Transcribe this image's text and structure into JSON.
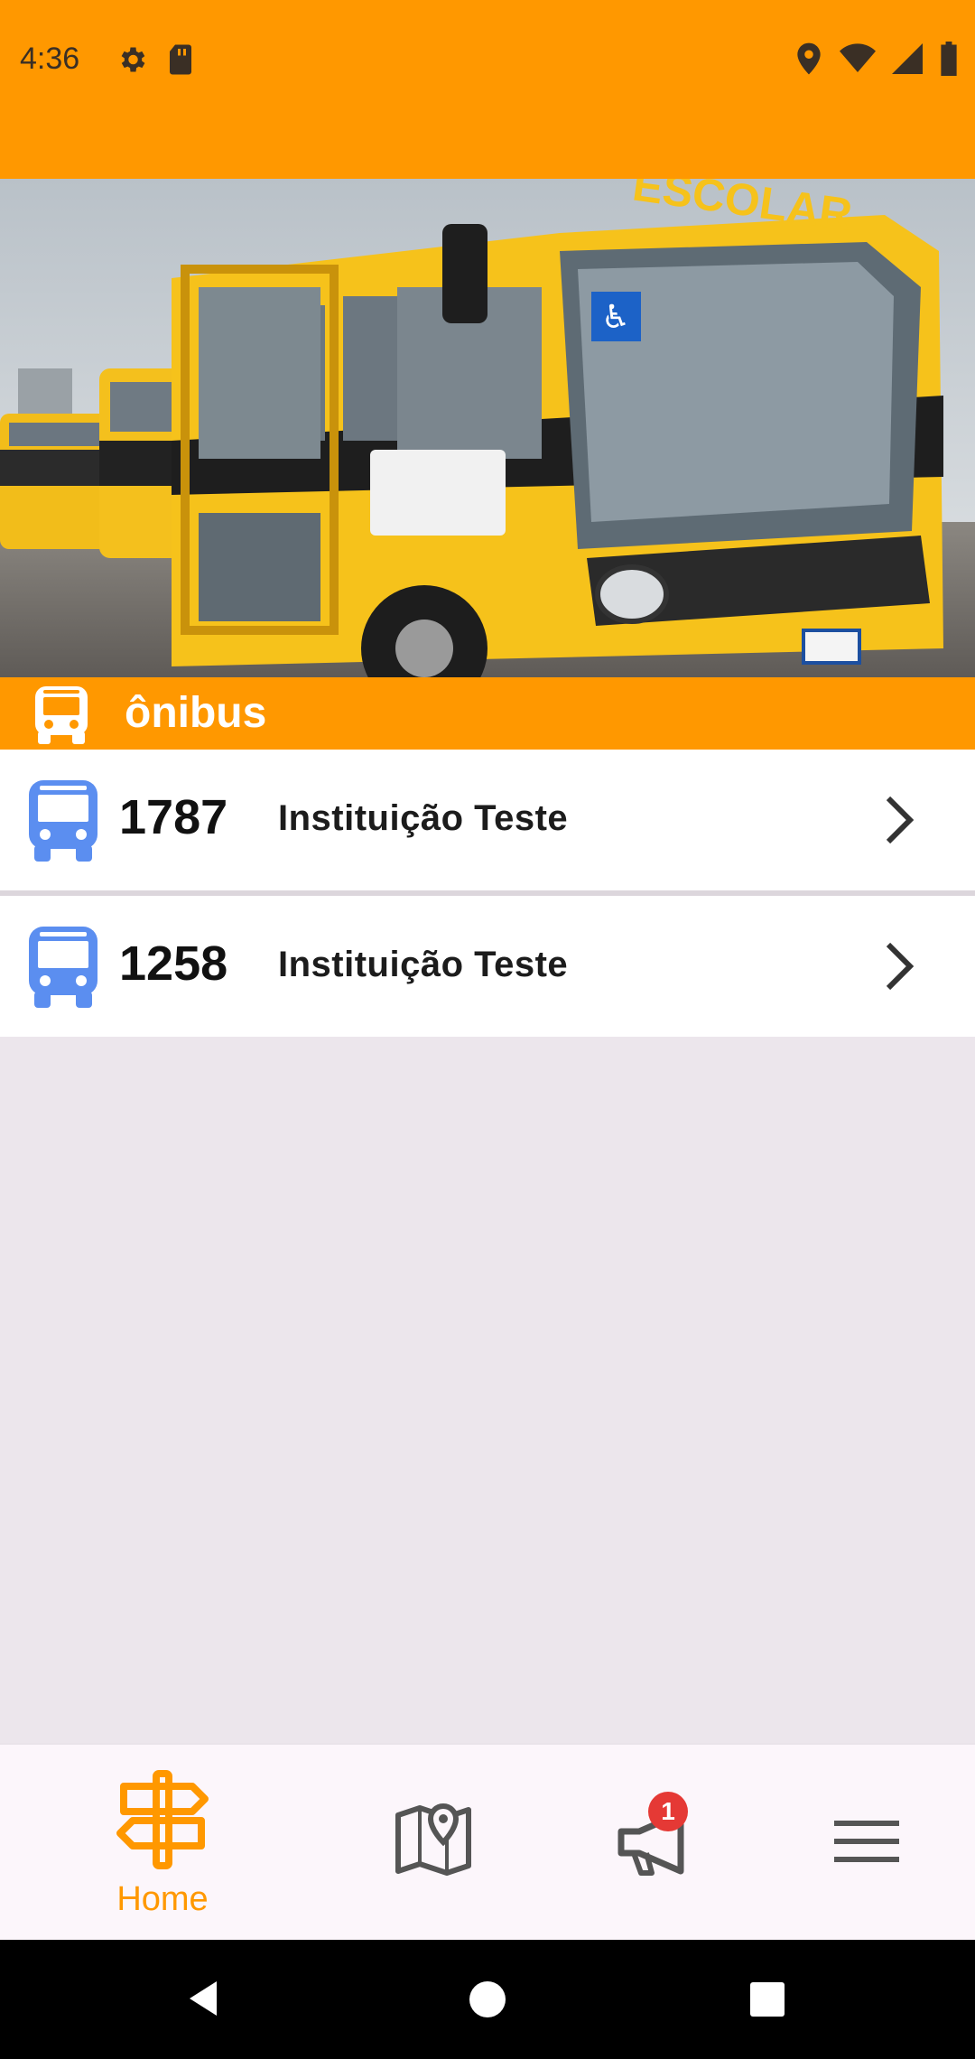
{
  "status_bar": {
    "time": "4:36",
    "left_icons": [
      "gear-icon",
      "sd-card-icon"
    ],
    "right_icons": [
      "location-icon",
      "wifi-icon",
      "signal-icon",
      "battery-icon"
    ],
    "background": "#ff9800"
  },
  "hero": {
    "description_icon": "school-bus-photo",
    "bus_sign": "ESCOLAR"
  },
  "section": {
    "title": "ônibus",
    "icon": "bus-icon"
  },
  "buses": [
    {
      "number": "1787",
      "institution": "Instituição Teste"
    },
    {
      "number": "1258",
      "institution": "Instituição Teste"
    }
  ],
  "bottom_nav": {
    "items": [
      {
        "label": "Home",
        "icon": "signpost-icon",
        "active": true
      },
      {
        "label": "",
        "icon": "map-icon",
        "active": false
      },
      {
        "label": "",
        "icon": "megaphone-icon",
        "active": false,
        "badge": "1"
      },
      {
        "label": "",
        "icon": "menu-icon",
        "active": false
      }
    ],
    "accent": "#ff9800",
    "inactive_color": "#555555"
  },
  "colors": {
    "accent": "#ff9800",
    "bus_icon": "#5b8ef0",
    "badge": "#e53935"
  }
}
